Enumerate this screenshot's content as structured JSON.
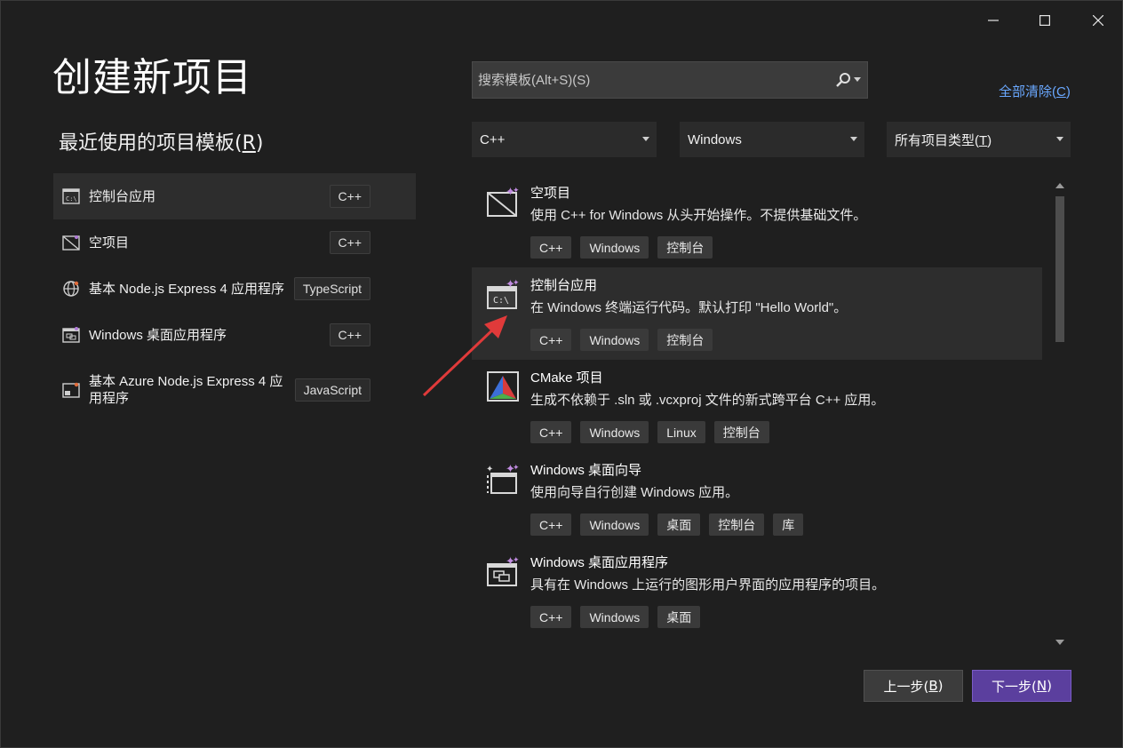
{
  "window": {
    "title": "创建新项目"
  },
  "recent": {
    "heading_prefix": "最近使用的项目模板(",
    "heading_key": "R",
    "heading_suffix": ")",
    "items": [
      {
        "label": "控制台应用",
        "tag": "C++",
        "icon": "console-app-icon"
      },
      {
        "label": "空项目",
        "tag": "C++",
        "icon": "empty-project-icon"
      },
      {
        "label": "基本 Node.js Express 4 应用程序",
        "tag": "TypeScript",
        "icon": "nodejs-globe-icon"
      },
      {
        "label": "Windows 桌面应用程序",
        "tag": "C++",
        "icon": "windows-desktop-app-icon"
      },
      {
        "label": "基本 Azure Node.js Express 4 应用程序",
        "tag": "JavaScript",
        "icon": "azure-nodejs-icon"
      }
    ]
  },
  "search": {
    "placeholder": "搜索模板(Alt+S)(S)"
  },
  "clear_all": {
    "prefix": "全部清除(",
    "key": "C",
    "suffix": ")"
  },
  "filters": {
    "language": "C++",
    "platform": "Windows",
    "project_type_prefix": "所有项目类型(",
    "project_type_key": "T",
    "project_type_suffix": ")"
  },
  "templates": [
    {
      "title": "空项目",
      "desc": "使用 C++ for Windows 从头开始操作。不提供基础文件。",
      "tags": [
        "C++",
        "Windows",
        "控制台"
      ],
      "icon": "empty-project-icon"
    },
    {
      "title": "控制台应用",
      "desc": "在 Windows 终端运行代码。默认打印 \"Hello World\"。",
      "tags": [
        "C++",
        "Windows",
        "控制台"
      ],
      "icon": "console-app-icon"
    },
    {
      "title": "CMake 项目",
      "desc": "生成不依赖于 .sln 或 .vcxproj 文件的新式跨平台 C++ 应用。",
      "tags": [
        "C++",
        "Windows",
        "Linux",
        "控制台"
      ],
      "icon": "cmake-icon"
    },
    {
      "title": "Windows 桌面向导",
      "desc": "使用向导自行创建 Windows 应用。",
      "tags": [
        "C++",
        "Windows",
        "桌面",
        "控制台",
        "库"
      ],
      "icon": "desktop-wizard-icon"
    },
    {
      "title": "Windows 桌面应用程序",
      "desc": "具有在 Windows 上运行的图形用户界面的应用程序的项目。",
      "tags": [
        "C++",
        "Windows",
        "桌面"
      ],
      "icon": "windows-desktop-app-icon"
    }
  ],
  "buttons": {
    "back_prefix": "上一步(",
    "back_key": "B",
    "back_suffix": ")",
    "next_prefix": "下一步(",
    "next_key": "N",
    "next_suffix": ")"
  },
  "colors": {
    "background": "#1f1f1f",
    "accent": "#5b3f9e",
    "link": "#6aa8ff",
    "annotation_arrow": "#e03a3a"
  }
}
